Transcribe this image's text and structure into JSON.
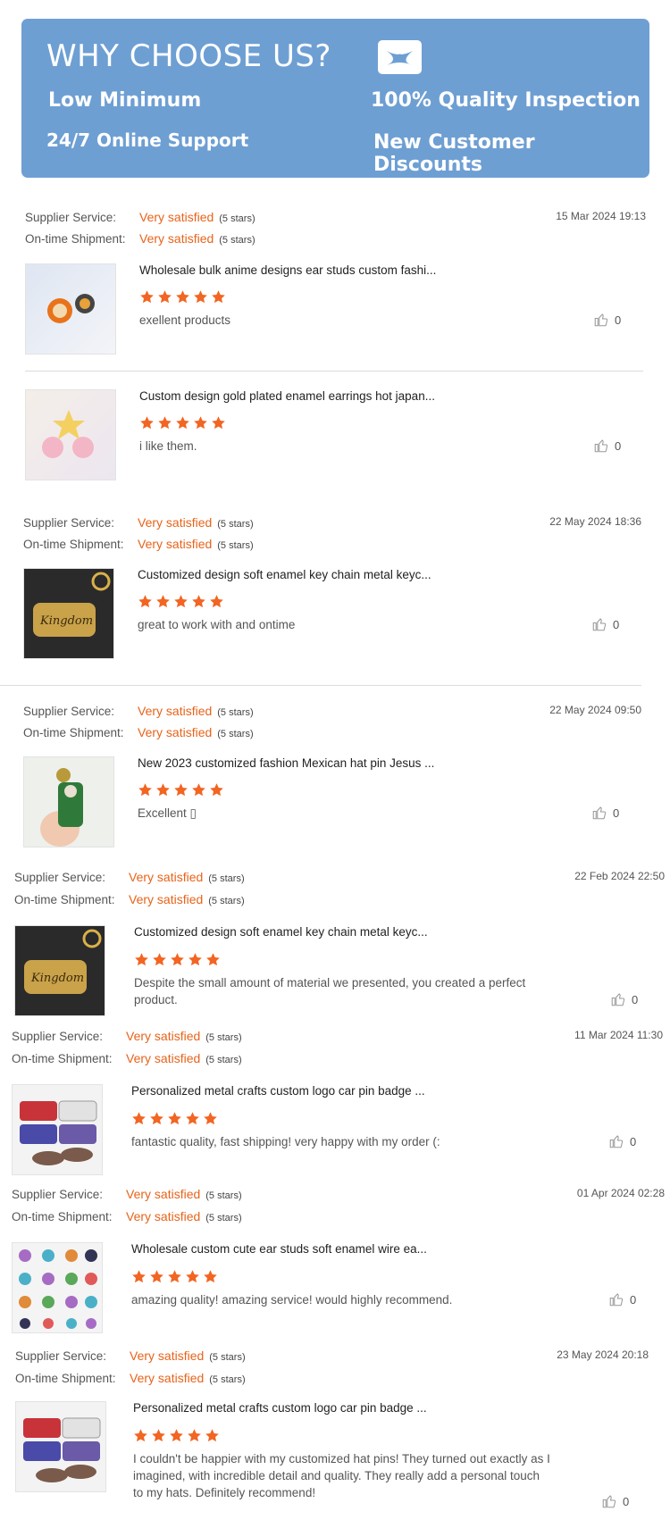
{
  "banner": {
    "title": "WHY CHOOSE US?",
    "features": [
      "Low Minimum",
      "100% Quality Inspection",
      "24/7 Online Support",
      "New Customer Discounts"
    ],
    "logo_icon": "close-x-icon",
    "background": "#6e9fd3"
  },
  "labels": {
    "supplier": "Supplier Service:",
    "shipment": "On-time Shipment:",
    "satisfied": "Very satisfied",
    "five_stars": "(5 stars)"
  },
  "colors": {
    "accent": "#e8631a",
    "star": "#f26522"
  },
  "reviews": [
    {
      "date": "15 Mar 2024 19:13",
      "title": "Wholesale bulk anime designs ear studs custom fashi...",
      "comment": "exellent products",
      "likes": "0",
      "rating": 5
    },
    {
      "date": "",
      "title": "Custom design gold plated enamel earrings hot japan...",
      "comment": "i like them.",
      "likes": "0",
      "rating": 5
    },
    {
      "date": "22 May 2024 18:36",
      "title": "Customized design soft enamel key chain metal keyc...",
      "comment": "great to work with and ontime",
      "likes": "0",
      "rating": 5
    },
    {
      "date": "22 May 2024 09:50",
      "title": "New 2023 customized fashion Mexican hat pin Jesus ...",
      "comment": "Excellent ▯",
      "likes": "0",
      "rating": 5
    },
    {
      "date": "22 Feb 2024 22:50",
      "title": "Customized design soft enamel key chain metal keyc...",
      "comment": "Despite the small amount of material we presented, you created a perfect product.",
      "likes": "0",
      "rating": 5
    },
    {
      "date": "11 Mar 2024 11:30",
      "title": "Personalized metal crafts custom logo car pin badge ...",
      "comment": "fantastic quality, fast shipping! very happy with my order (:",
      "likes": "0",
      "rating": 5
    },
    {
      "date": "01 Apr 2024 02:28",
      "title": "Wholesale custom cute ear studs soft enamel wire ea...",
      "comment": "amazing quality! amazing service! would highly recommend.",
      "likes": "0",
      "rating": 5
    },
    {
      "date": "23 May 2024 20:18",
      "title": "Personalized metal crafts custom logo car pin badge ...",
      "comment": "I couldn't be happier with my customized hat pins! They turned out exactly as I imagined, with incredible detail and quality. They really add a personal touch to my hats. Definitely recommend!",
      "likes": "0",
      "rating": 5
    }
  ]
}
